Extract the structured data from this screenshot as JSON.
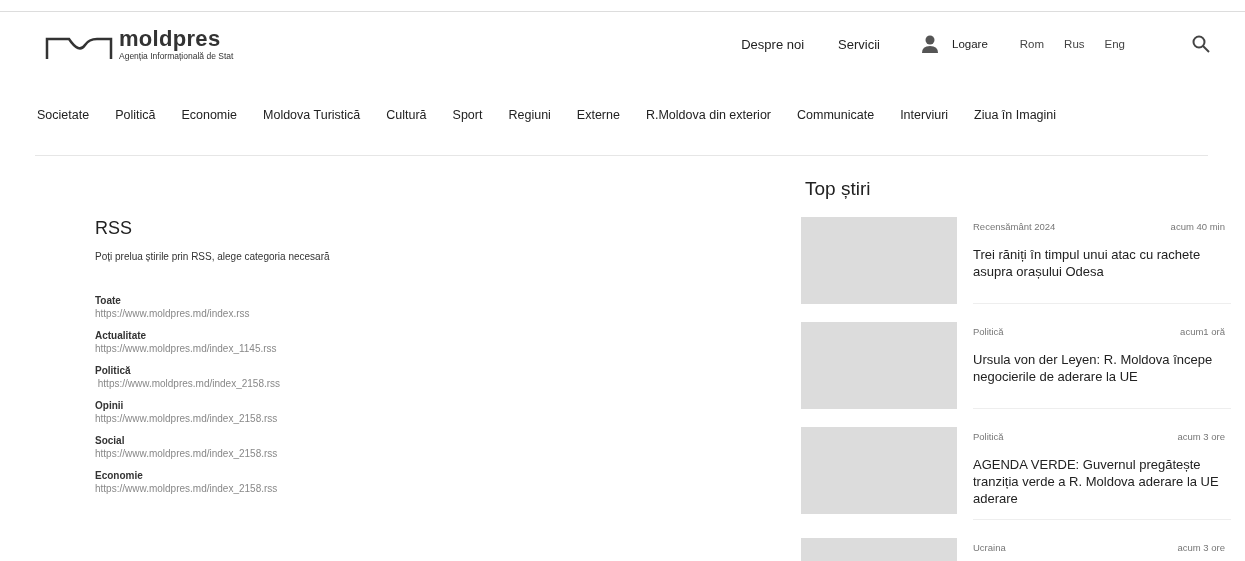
{
  "header": {
    "logo": {
      "name": "moldpres",
      "tagline": "Agenția Informațională de Stat"
    },
    "links": [
      "Despre noi",
      "Servicii"
    ],
    "login": "Logare",
    "languages": [
      "Rom",
      "Rus",
      "Eng"
    ]
  },
  "nav": [
    "Societate",
    "Politică",
    "Economie",
    "Moldova Turistică",
    "Cultură",
    "Sport",
    "Regiuni",
    "Externe",
    "R.Moldova din exterior",
    "Communicate",
    "Interviuri",
    "Ziua în Imagini"
  ],
  "rss": {
    "title": "RSS",
    "intro": "Poți prelua știrile prin RSS, alege categoria necesară",
    "feeds": [
      {
        "name": "Toate",
        "url": "https://www.moldpres.md/index.rss"
      },
      {
        "name": "Actualitate",
        "url": "https://www.moldpres.md/index_1145.rss"
      },
      {
        "name": "Politică",
        "url": " https://www.moldpres.md/index_2158.rss"
      },
      {
        "name": "Opinii",
        "url": "https://www.moldpres.md/index_2158.rss"
      },
      {
        "name": "Social",
        "url": "https://www.moldpres.md/index_2158.rss"
      },
      {
        "name": "Economie",
        "url": "https://www.moldpres.md/index_2158.rss"
      }
    ]
  },
  "top_news": {
    "title": "Top știri",
    "items": [
      {
        "category": "Recensământ 2024",
        "time": "acum 40 min",
        "headline": "Trei răniți în timpul unui atac cu rachete asupra orașului Odesa"
      },
      {
        "category": "Politică",
        "time": "acum1 oră",
        "headline": "Ursula von der Leyen: R. Moldova începe negocierile de aderare la UE"
      },
      {
        "category": "Politică",
        "time": "acum 3 ore",
        "headline": "AGENDA VERDE: Guvernul pregătește tranziția verde a R. Moldova aderare la UE aderare"
      },
      {
        "category": "Ucraina",
        "time": "acum 3 ore"
      }
    ]
  }
}
